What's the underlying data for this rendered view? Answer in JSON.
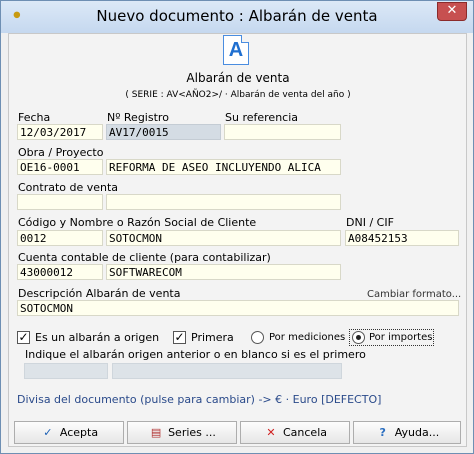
{
  "window": {
    "title": "Nuevo documento : Albarán de venta",
    "close_label": "✕"
  },
  "header": {
    "doc_icon_letter": "A",
    "title": "Albarán de venta",
    "subtitle": "( SERIE : AV<AÑO2>/ · Albarán de venta del año )"
  },
  "fields": {
    "fecha": {
      "label": "Fecha",
      "value": "12/03/2017"
    },
    "registro": {
      "label": "Nº Registro",
      "value": "AV17/0015"
    },
    "referencia": {
      "label": "Su referencia",
      "value": ""
    },
    "obra": {
      "label": "Obra / Proyecto",
      "code": "OE16-0001",
      "name": "REFORMA DE ASEO INCLUYENDO ALICA"
    },
    "contrato": {
      "label": "Contrato de venta",
      "code": "",
      "name": ""
    },
    "cliente": {
      "label": "Código y Nombre o Razón Social de Cliente",
      "code": "0012",
      "name": "SOTOCMON"
    },
    "dni": {
      "label": "DNI / CIF",
      "value": "A08452153"
    },
    "cuenta": {
      "label": "Cuenta contable de cliente (para contabilizar)",
      "code": "43000012",
      "name": "SOFTWARECOM"
    },
    "descripcion": {
      "label": "Descripción Albarán de venta",
      "value": "SOTOCMON",
      "link": "Cambiar formato..."
    }
  },
  "options": {
    "es_origen": {
      "label": "Es un albarán a origen",
      "checked": true
    },
    "primera": {
      "label": "Primera",
      "checked": true
    },
    "por_mediciones": {
      "label": "Por mediciones",
      "selected": false
    },
    "por_importes": {
      "label": "Por importes",
      "selected": true
    },
    "hint": "Indique el albarán origen anterior o en blanco si es el primero"
  },
  "divisa": "Divisa del documento (pulse para cambiar) -> € · Euro [DEFECTO]",
  "buttons": {
    "acepta": "Acepta",
    "series": "Series ...",
    "cancela": "Cancela",
    "ayuda": "Ayuda..."
  }
}
